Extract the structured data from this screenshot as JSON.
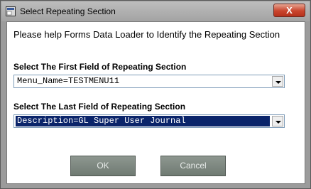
{
  "window": {
    "title": "Select Repeating Section",
    "close_label": "X"
  },
  "dialog": {
    "prompt": "Please help Forms Data Loader to Identify the Repeating Section",
    "first_field": {
      "label": "Select The First Field of Repeating Section",
      "value": "Menu_Name=TESTMENU11"
    },
    "last_field": {
      "label": "Select The Last Field of Repeating Section",
      "value": "Description=GL Super User Journal"
    }
  },
  "buttons": {
    "ok": "OK",
    "cancel": "Cancel"
  },
  "icons": {
    "app": "app-icon",
    "dropdown": "chevron-down-icon"
  }
}
